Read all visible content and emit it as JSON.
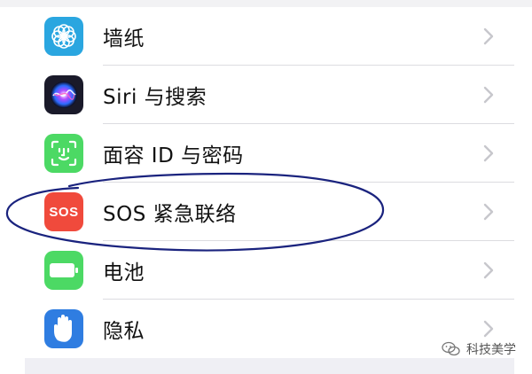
{
  "settings": {
    "items": [
      {
        "label": "墙纸",
        "icon": "wallpaper-icon"
      },
      {
        "label": "Siri 与搜索",
        "icon": "siri-icon"
      },
      {
        "label": "面容 ID 与密码",
        "icon": "face-id-icon"
      },
      {
        "label": "SOS 紧急联络",
        "icon": "sos-icon",
        "icon_text": "SOS"
      },
      {
        "label": "电池",
        "icon": "battery-icon"
      },
      {
        "label": "隐私",
        "icon": "privacy-hand-icon"
      }
    ]
  },
  "watermark": {
    "text": "科技美学"
  },
  "colors": {
    "wallpaper": "#2aa6e0",
    "siri": "#1a1a2a",
    "face_id": "#4cd964",
    "sos": "#f04a3c",
    "battery": "#4cd964",
    "privacy": "#2f7de1",
    "annotation": "#1a237e",
    "chevron": "#c7c7cc"
  }
}
